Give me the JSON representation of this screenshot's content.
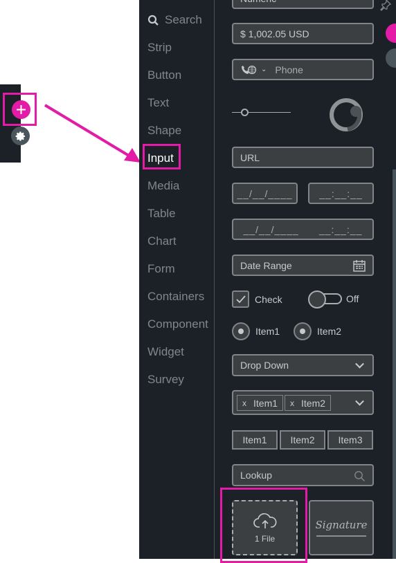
{
  "left_toolbar": {
    "add_icon": "plus-icon",
    "settings_icon": "gear-icon"
  },
  "categories": {
    "search_label": "Search",
    "items": [
      "Strip",
      "Button",
      "Text",
      "Shape",
      "Input",
      "Media",
      "Table",
      "Chart",
      "Form",
      "Containers",
      "Component",
      "Widget",
      "Survey"
    ],
    "active": "Input"
  },
  "widgets": {
    "numeric_label": "Numeric",
    "currency_value": "$ 1,002.05 USD",
    "phone_placeholder": "Phone",
    "url_placeholder": "URL",
    "date_mask": "__/__/____",
    "time_mask": "__:__:__",
    "datetime_date_mask": "__/__/____",
    "datetime_time_mask": "__:__:__",
    "date_range_placeholder": "Date Range",
    "checkbox_label": "Check",
    "checkbox_checked": true,
    "toggle_label": "Off",
    "radio_items": [
      "Item1",
      "Item2"
    ],
    "dropdown_placeholder": "Drop Down",
    "multiselect_chips": [
      "Item1",
      "Item2"
    ],
    "chip_remove": "x",
    "segment_items": [
      "Item1",
      "Item2",
      "Item3"
    ],
    "lookup_placeholder": "Lookup",
    "upload_label": "1 File",
    "signature_label": "Signature",
    "slider_value_fraction": 0.2,
    "progress_ring_fraction": 0.72
  },
  "annotation_color": "#e21ca6"
}
